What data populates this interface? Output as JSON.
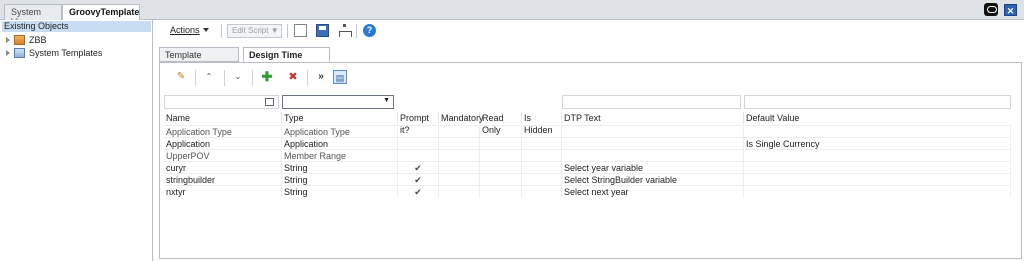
{
  "top_tabs": [
    "System View",
    "GroovyTemplate"
  ],
  "left_panel": {
    "header": "Existing Objects",
    "items": [
      {
        "label": "ZBB",
        "icon": "object-icon"
      },
      {
        "label": "System Templates",
        "icon": "template-icon"
      }
    ]
  },
  "toolbar": {
    "actions_label": "Actions",
    "edit_script_label": "Edit Script"
  },
  "sub_tabs": [
    "Template Designer",
    "Design Time Prompt"
  ],
  "grid": {
    "columns": [
      "Name",
      "Type",
      "Prompt it?",
      "Mandatory",
      "Read Only",
      "Is Hidden",
      "DTP Text",
      "Default Value"
    ],
    "rows": [
      {
        "name": "Application Type",
        "type": "Application Type",
        "prompt": "",
        "dtp_text": "",
        "default": "",
        "muted": true
      },
      {
        "name": "Application",
        "type": "Application",
        "prompt": "",
        "dtp_text": "",
        "default": "Is Single Currency",
        "muted": false
      },
      {
        "name": "UpperPOV",
        "type": "Member Range",
        "prompt": "",
        "dtp_text": "",
        "default": "",
        "muted": true
      },
      {
        "name": "curyr",
        "type": "String",
        "prompt": "✔",
        "dtp_text": "Select year variable",
        "default": "",
        "muted": false
      },
      {
        "name": "stringbuilder",
        "type": "String",
        "prompt": "✔",
        "dtp_text": "Select StringBuilder variable",
        "default": "",
        "muted": false
      },
      {
        "name": "nxtyr",
        "type": "String",
        "prompt": "✔",
        "dtp_text": "Select next year",
        "default": "",
        "muted": false
      }
    ]
  },
  "icons": [
    "close-icon",
    "oracle-icon",
    "new-document-icon",
    "save-icon",
    "tree-icon",
    "help-icon",
    "edit-icon",
    "move-up-icon",
    "move-down-icon",
    "add-icon",
    "delete-icon",
    "more-icon",
    "design-time-prompt-icon",
    "filter-icon"
  ]
}
